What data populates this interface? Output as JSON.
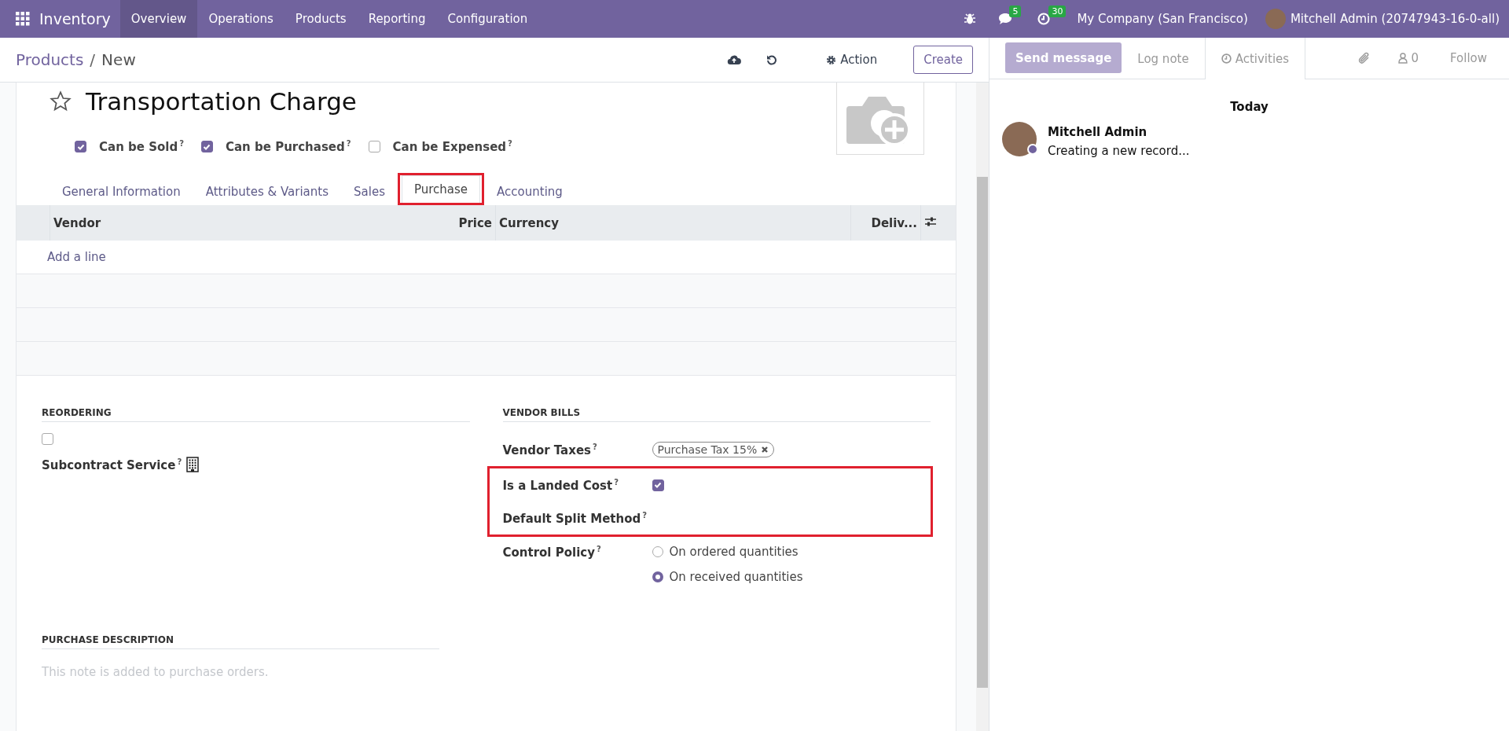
{
  "navbar": {
    "app": "Inventory",
    "menu": [
      {
        "label": "Overview",
        "selected": true
      },
      {
        "label": "Operations",
        "selected": false
      },
      {
        "label": "Products",
        "selected": false
      },
      {
        "label": "Reporting",
        "selected": false
      },
      {
        "label": "Configuration",
        "selected": false
      }
    ],
    "messages_count": "5",
    "activities_count": "30",
    "company": "My Company (San Francisco)",
    "user": "Mitchell Admin (20747943-16-0-all)"
  },
  "control_panel": {
    "breadcrumb": [
      "Products",
      "New"
    ],
    "separator": "/",
    "action": "Action",
    "create": "Create"
  },
  "product": {
    "name": "Transportation Charge",
    "favorite": false,
    "options": [
      {
        "label": "Can be Sold$^{?}$",
        "checked": true
      },
      {
        "label": "Can be Purchased$^{?}$",
        "checked": true
      },
      {
        "label": "Can be Expensed$^{?}$",
        "checked": false
      }
    ]
  },
  "tabs": [
    {
      "label": "General Information",
      "selected": false,
      "highlighted": false
    },
    {
      "label": "Attributes & Variants",
      "selected": false,
      "highlighted": false
    },
    {
      "label": "Sales",
      "selected": false,
      "highlighted": false
    },
    {
      "label": "Purchase",
      "selected": true,
      "highlighted": true
    },
    {
      "label": "Accounting",
      "selected": false,
      "highlighted": false
    }
  ],
  "vendor_table": {
    "columns": [
      "Vendor",
      "Price",
      "Currency",
      "Deliv..."
    ],
    "add_line": "Add a line"
  },
  "reordering": {
    "title": "REORDERING",
    "checked": false,
    "field_label": "Subcontract Service$^{?}$"
  },
  "vendor_bills": {
    "title": "VENDOR BILLS",
    "fields": [
      {
        "kind": "tags",
        "label": "Vendor Taxes$^{?}$",
        "tags": [
          "Purchase Tax 15%"
        ],
        "highlighted": false
      },
      {
        "kind": "checkbox",
        "label": "Is a Landed Cost$^{?}$",
        "checked": true,
        "highlighted": true
      },
      {
        "kind": "empty",
        "label": "Default Split Method$^{?}$",
        "highlighted": true
      },
      {
        "kind": "radio",
        "label": "Control Policy$^{?}$",
        "highlighted": false,
        "options": [
          {
            "label": "On ordered quantities",
            "selected": false
          },
          {
            "label": "On received quantities",
            "selected": true
          }
        ]
      }
    ]
  },
  "purchase_description": {
    "title": "PURCHASE DESCRIPTION",
    "placeholder": "This note is added to purchase orders."
  },
  "chatter": {
    "send": "Send message",
    "log": "Log note",
    "activities": "Activities",
    "followers": "0",
    "follow": "Follow",
    "date": "Today",
    "messages": [
      {
        "author": "Mitchell Admin",
        "body": "Creating a new record..."
      }
    ]
  }
}
